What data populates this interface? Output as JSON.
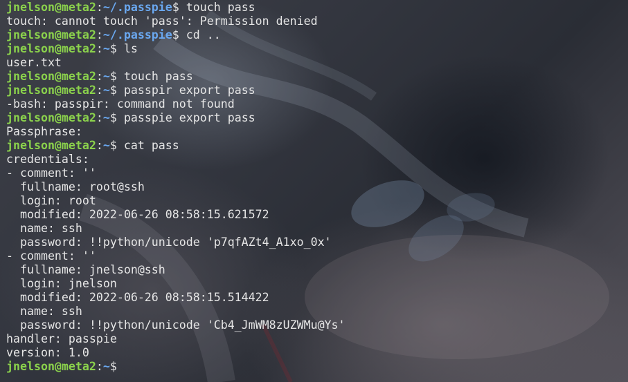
{
  "window": {
    "type": "terminal",
    "colors": {
      "prompt_user": "#8bd24c",
      "prompt_path": "#6aa8f0",
      "text": "#e6e6e6"
    }
  },
  "lines": [
    {
      "kind": "prompt",
      "user": "jnelson@meta2",
      "path": "~/.passpie",
      "symbol": "$ ",
      "command": "touch pass"
    },
    {
      "kind": "output",
      "text": "touch: cannot touch 'pass': Permission denied"
    },
    {
      "kind": "prompt",
      "user": "jnelson@meta2",
      "path": "~/.passpie",
      "symbol": "$ ",
      "command": "cd .."
    },
    {
      "kind": "prompt",
      "user": "jnelson@meta2",
      "path": "~",
      "symbol": "$ ",
      "command": "ls"
    },
    {
      "kind": "output",
      "text": "user.txt"
    },
    {
      "kind": "prompt",
      "user": "jnelson@meta2",
      "path": "~",
      "symbol": "$ ",
      "command": "touch pass"
    },
    {
      "kind": "prompt",
      "user": "jnelson@meta2",
      "path": "~",
      "symbol": "$ ",
      "command": "passpir export pass"
    },
    {
      "kind": "output",
      "text": "-bash: passpir: command not found"
    },
    {
      "kind": "prompt",
      "user": "jnelson@meta2",
      "path": "~",
      "symbol": "$ ",
      "command": "passpie export pass"
    },
    {
      "kind": "output",
      "text": "Passphrase:"
    },
    {
      "kind": "prompt",
      "user": "jnelson@meta2",
      "path": "~",
      "symbol": "$ ",
      "command": "cat pass"
    },
    {
      "kind": "output",
      "text": "credentials:"
    },
    {
      "kind": "output",
      "text": "- comment: ''"
    },
    {
      "kind": "output",
      "text": "  fullname: root@ssh"
    },
    {
      "kind": "output",
      "text": "  login: root"
    },
    {
      "kind": "output",
      "text": "  modified: 2022-06-26 08:58:15.621572"
    },
    {
      "kind": "output",
      "text": "  name: ssh"
    },
    {
      "kind": "output",
      "text": "  password: !!python/unicode 'p7qfAZt4_A1xo_0x'"
    },
    {
      "kind": "output",
      "text": "- comment: ''"
    },
    {
      "kind": "output",
      "text": "  fullname: jnelson@ssh"
    },
    {
      "kind": "output",
      "text": "  login: jnelson"
    },
    {
      "kind": "output",
      "text": "  modified: 2022-06-26 08:58:15.514422"
    },
    {
      "kind": "output",
      "text": "  name: ssh"
    },
    {
      "kind": "output",
      "text": "  password: !!python/unicode 'Cb4_JmWM8zUZWMu@Ys'"
    },
    {
      "kind": "output",
      "text": "handler: passpie"
    },
    {
      "kind": "output",
      "text": "version: 1.0"
    },
    {
      "kind": "prompt",
      "user": "jnelson@meta2",
      "path": "~",
      "symbol": "$ ",
      "command": ""
    }
  ]
}
